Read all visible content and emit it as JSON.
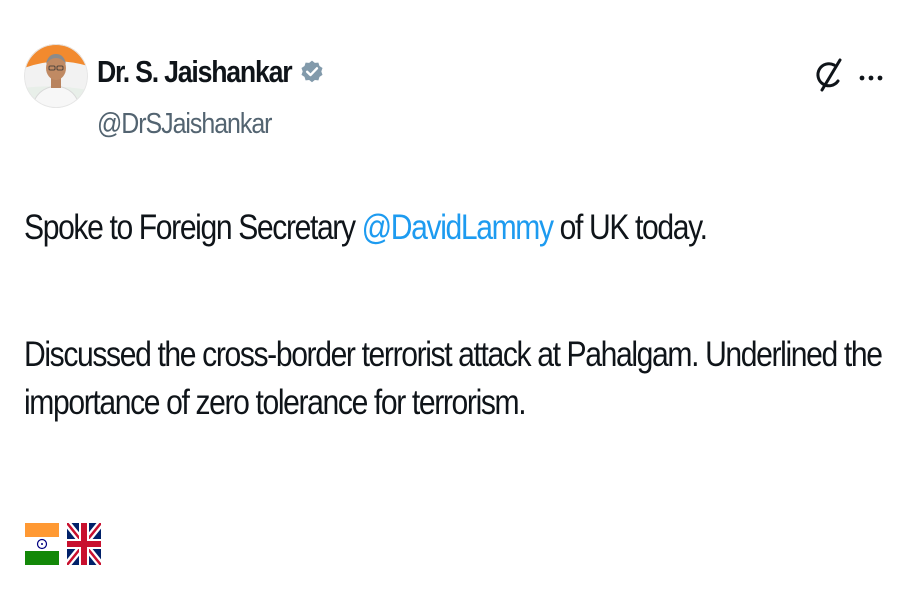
{
  "author": {
    "display_name": "Dr. S. Jaishankar",
    "handle": "@DrSJaishankar",
    "verified": true,
    "avatar_icon": "profile-photo"
  },
  "actions": {
    "grok_icon": "grok-icon",
    "more_icon": "more-horizontal-icon"
  },
  "tweet": {
    "para1_before": "Spoke to Foreign Secretary ",
    "para1_mention": "@DavidLammy",
    "para1_after": " of UK today.",
    "para2_line1": "Discussed the cross-border terrorist attack at Pahalgam. Underlined the",
    "para2_line2": "importance of zero tolerance for terrorism.",
    "emoji": [
      "flag-india",
      "flag-united-kingdom"
    ]
  },
  "colors": {
    "link": "#1d9bf0",
    "secondary_text": "#536471",
    "primary_text": "#0f1419",
    "verified_badge": "#829aab"
  }
}
